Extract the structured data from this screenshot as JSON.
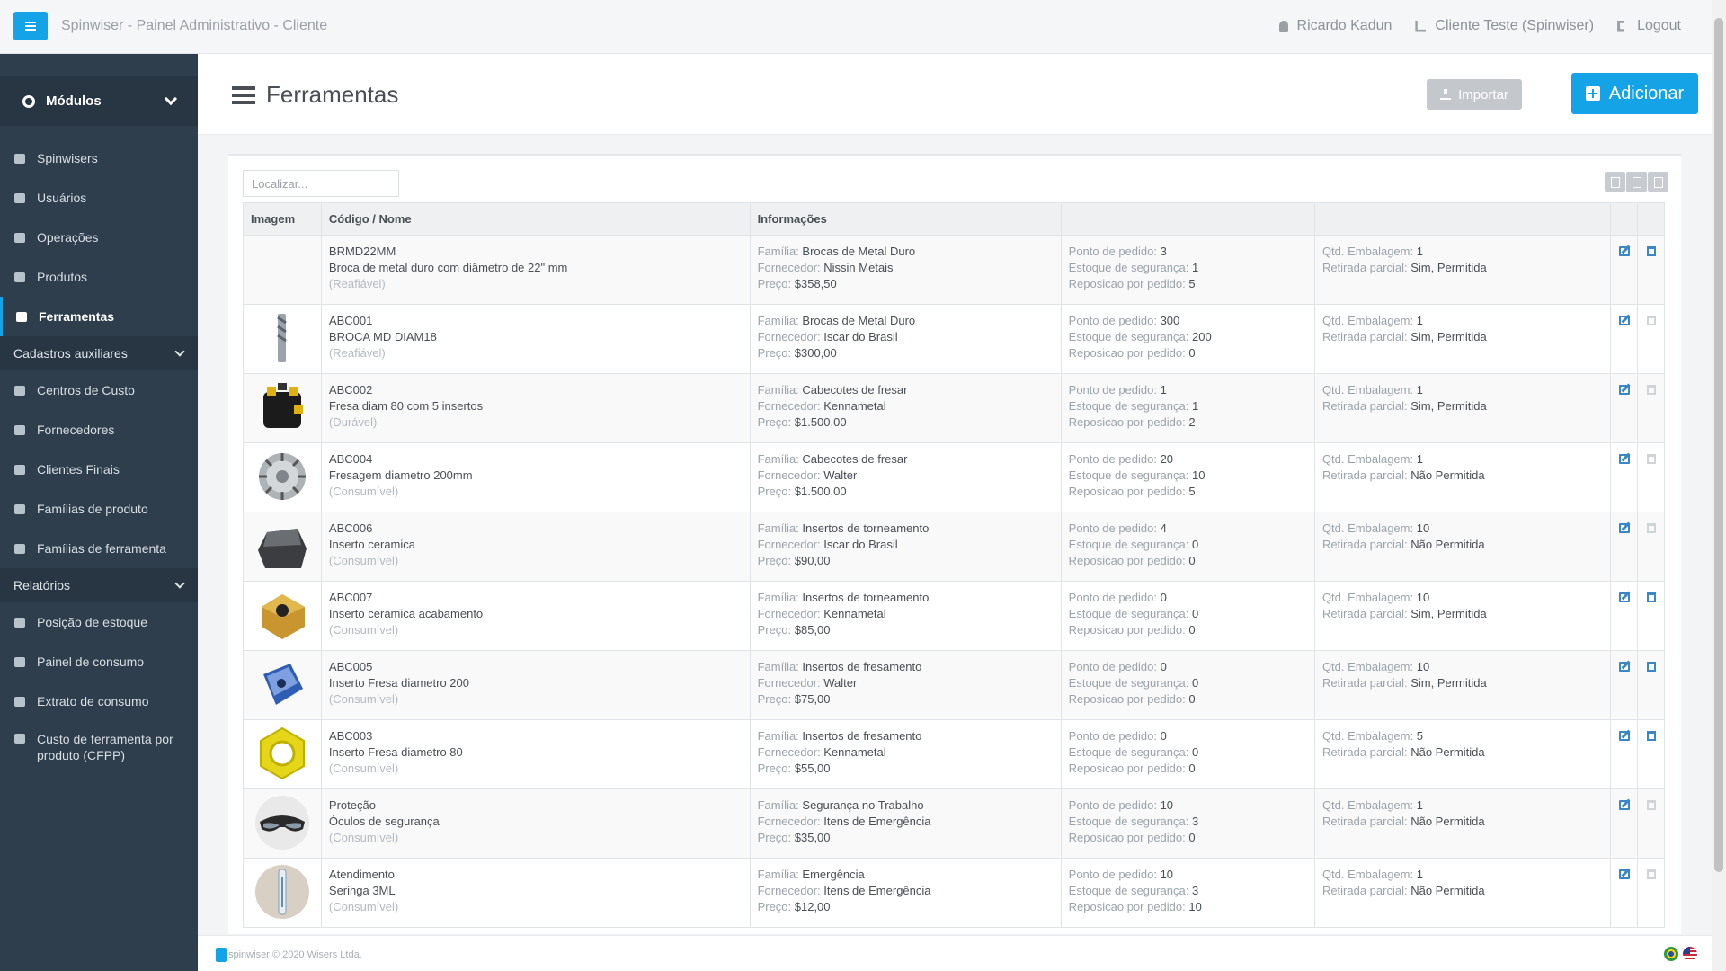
{
  "app_title": "Spinwiser - Painel Administrativo - Cliente",
  "user": {
    "name": "Ricardo Kadun",
    "client": "Cliente Teste (Spinwiser)",
    "logout": "Logout"
  },
  "sidebar": {
    "modules_label": "Módulos",
    "items": [
      {
        "label": "Spinwisers",
        "icon": "database-icon"
      },
      {
        "label": "Usuários",
        "icon": "user-circle-icon"
      },
      {
        "label": "Operações",
        "icon": "list-icon"
      },
      {
        "label": "Produtos",
        "icon": "globe-icon"
      },
      {
        "label": "Ferramentas",
        "icon": "tools-icon",
        "active": true
      }
    ],
    "section_aux": "Cadastros auxiliares",
    "aux_items": [
      {
        "label": "Centros de Custo",
        "icon": "id-card-icon"
      },
      {
        "label": "Fornecedores",
        "icon": "puzzle-icon"
      },
      {
        "label": "Clientes Finais",
        "icon": "cubes-icon"
      },
      {
        "label": "Famílias de produto",
        "icon": "object-group-icon"
      },
      {
        "label": "Famílias de ferramenta",
        "icon": "object-group-icon"
      }
    ],
    "section_reports": "Relatórios",
    "report_items": [
      {
        "label": "Posição de estoque",
        "icon": "list-ul-icon"
      },
      {
        "label": "Painel de consumo",
        "icon": "bar-chart-icon"
      },
      {
        "label": "Extrato de consumo",
        "icon": "list-alt-icon"
      },
      {
        "label": "Custo de ferramenta por produto (CFPP)",
        "icon": "money-icon"
      }
    ]
  },
  "page": {
    "title": "Ferramentas",
    "import_label": "Importar",
    "add_label": "Adicionar",
    "search_placeholder": "Localizar..."
  },
  "labels": {
    "familia": "Família: ",
    "fornecedor": "Fornecedor: ",
    "preco": "Preço: ",
    "ponto": "Ponto de pedido: ",
    "estoque": "Estoque de segurança: ",
    "reposicao": "Reposicao por pedido: ",
    "qtd": "Qtd. Embalagem: ",
    "retirada": "Retirada parcial: "
  },
  "table": {
    "headers": [
      "Imagem",
      "Código / Nome",
      "Informações",
      "",
      "",
      "",
      ""
    ],
    "rows": [
      {
        "code": "BRMD22MM",
        "name": "Broca de metal duro com diâmetro de 22\" mm",
        "type": "(Reafiável)",
        "familia": "Brocas de Metal Duro",
        "fornecedor": "Nissin Metais",
        "preco": "$358,50",
        "ponto": "3",
        "estoque": "1",
        "reposicao": "5",
        "qtd": "1",
        "retirada": "Sim, Permitida",
        "image": "none",
        "trash_enabled": true
      },
      {
        "code": "ABC001",
        "name": "BROCA MD DIAM18",
        "type": "(Reafiável)",
        "familia": "Brocas de Metal Duro",
        "fornecedor": "Iscar do Brasil",
        "preco": "$300,00",
        "ponto": "300",
        "estoque": "200",
        "reposicao": "0",
        "qtd": "1",
        "retirada": "Sim, Permitida",
        "image": "drill",
        "trash_enabled": false
      },
      {
        "code": "ABC002",
        "name": "Fresa diam 80 com 5 insertos",
        "type": "(Durável)",
        "familia": "Cabecotes de fresar",
        "fornecedor": "Kennametal",
        "preco": "$1.500,00",
        "ponto": "1",
        "estoque": "1",
        "reposicao": "2",
        "qtd": "1",
        "retirada": "Sim, Permitida",
        "image": "mill-head",
        "trash_enabled": false
      },
      {
        "code": "ABC004",
        "name": "Fresagem diametro 200mm",
        "type": "(Consumível)",
        "familia": "Cabecotes de fresar",
        "fornecedor": "Walter",
        "preco": "$1.500,00",
        "ponto": "20",
        "estoque": "10",
        "reposicao": "5",
        "qtd": "1",
        "retirada": "Não Permitida",
        "image": "mill-disc",
        "trash_enabled": false
      },
      {
        "code": "ABC006",
        "name": "Inserto ceramica",
        "type": "(Consumível)",
        "familia": "Insertos de torneamento",
        "fornecedor": "Iscar do Brasil",
        "preco": "$90,00",
        "ponto": "4",
        "estoque": "0",
        "reposicao": "0",
        "qtd": "10",
        "retirada": "Não Permitida",
        "image": "insert-black",
        "trash_enabled": false
      },
      {
        "code": "ABC007",
        "name": "Inserto ceramica acabamento",
        "type": "(Consumível)",
        "familia": "Insertos de torneamento",
        "fornecedor": "Kennametal",
        "preco": "$85,00",
        "ponto": "0",
        "estoque": "0",
        "reposicao": "0",
        "qtd": "10",
        "retirada": "Sim, Permitida",
        "image": "insert-gold",
        "trash_enabled": true
      },
      {
        "code": "ABC005",
        "name": "Inserto Fresa diametro 200",
        "type": "(Consumível)",
        "familia": "Insertos de fresamento",
        "fornecedor": "Walter",
        "preco": "$75,00",
        "ponto": "0",
        "estoque": "0",
        "reposicao": "0",
        "qtd": "10",
        "retirada": "Sim, Permitida",
        "image": "insert-blue",
        "trash_enabled": true
      },
      {
        "code": "ABC003",
        "name": "Inserto Fresa diametro 80",
        "type": "(Consumível)",
        "familia": "Insertos de fresamento",
        "fornecedor": "Kennametal",
        "preco": "$55,00",
        "ponto": "0",
        "estoque": "0",
        "reposicao": "0",
        "qtd": "5",
        "retirada": "Não Permitida",
        "image": "insert-yellow",
        "trash_enabled": true
      },
      {
        "code": "Proteção",
        "name": "Óculos de segurança",
        "type": "(Consumível)",
        "familia": "Segurança no Trabalho",
        "fornecedor": "Itens de Emergência",
        "preco": "$35,00",
        "ponto": "10",
        "estoque": "3",
        "reposicao": "0",
        "qtd": "1",
        "retirada": "Não Permitida",
        "image": "goggles",
        "trash_enabled": false
      },
      {
        "code": "Atendimento",
        "name": "Seringa 3ML",
        "type": "(Consumível)",
        "familia": "Emergência",
        "fornecedor": "Itens de Emergência",
        "preco": "$12,00",
        "ponto": "10",
        "estoque": "3",
        "reposicao": "10",
        "qtd": "1",
        "retirada": "Não Permitida",
        "image": "syringe",
        "trash_enabled": false
      }
    ]
  },
  "footer": {
    "brand": "spinwiser",
    "text": "© 2020 Wisers Ltda."
  }
}
